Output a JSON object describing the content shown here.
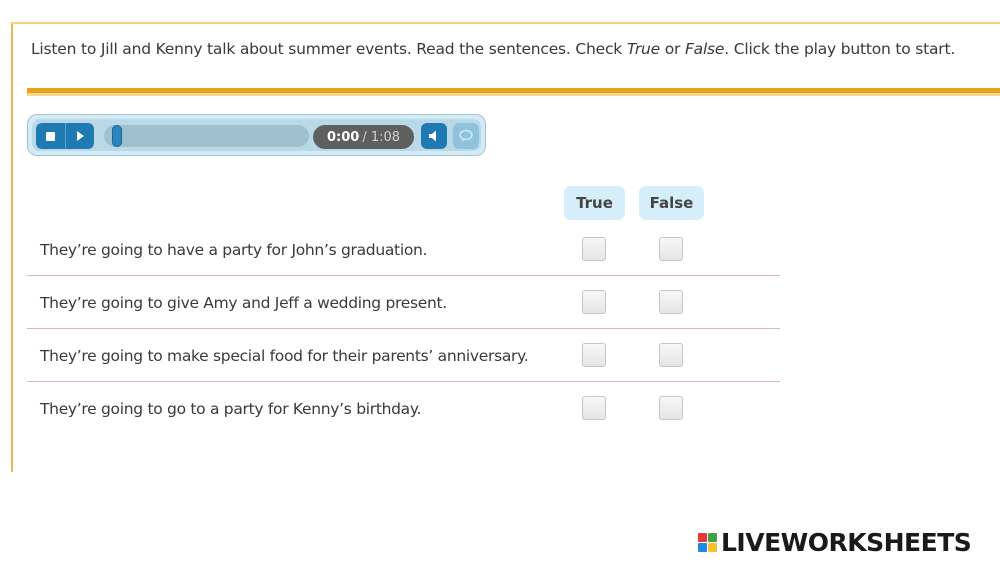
{
  "instructions": {
    "part1": "Listen to Jill and Kenny talk about summer events. Read the sentences. Check ",
    "em1": "True",
    "part2": " or ",
    "em2": "False",
    "part3": ". Click the play button to start."
  },
  "player": {
    "current_time": "0:00",
    "duration": "/ 1:08",
    "progress": 0,
    "icons": {
      "stop": "stop-icon",
      "play": "play-icon",
      "volume": "volume-icon",
      "captions": "captions-icon"
    }
  },
  "table": {
    "headers": {
      "true": "True",
      "false": "False"
    },
    "rows": [
      {
        "text": "They’re going to have a party for John’s graduation.",
        "true_checked": false,
        "false_checked": false
      },
      {
        "text": "They’re going to give Amy and Jeff a wedding present.",
        "true_checked": false,
        "false_checked": false
      },
      {
        "text": "They’re going to make special food for their parents’ anniversary.",
        "true_checked": false,
        "false_checked": false
      },
      {
        "text": "They’re going to go to a party for Kenny’s birthday.",
        "true_checked": false,
        "false_checked": false
      }
    ]
  },
  "logo": {
    "text": "LIVEWORKSHEETS"
  },
  "colors": {
    "accent_orange": "#e8a21f",
    "player_blue": "#1f7ab3",
    "header_bg": "#d6eefa"
  }
}
